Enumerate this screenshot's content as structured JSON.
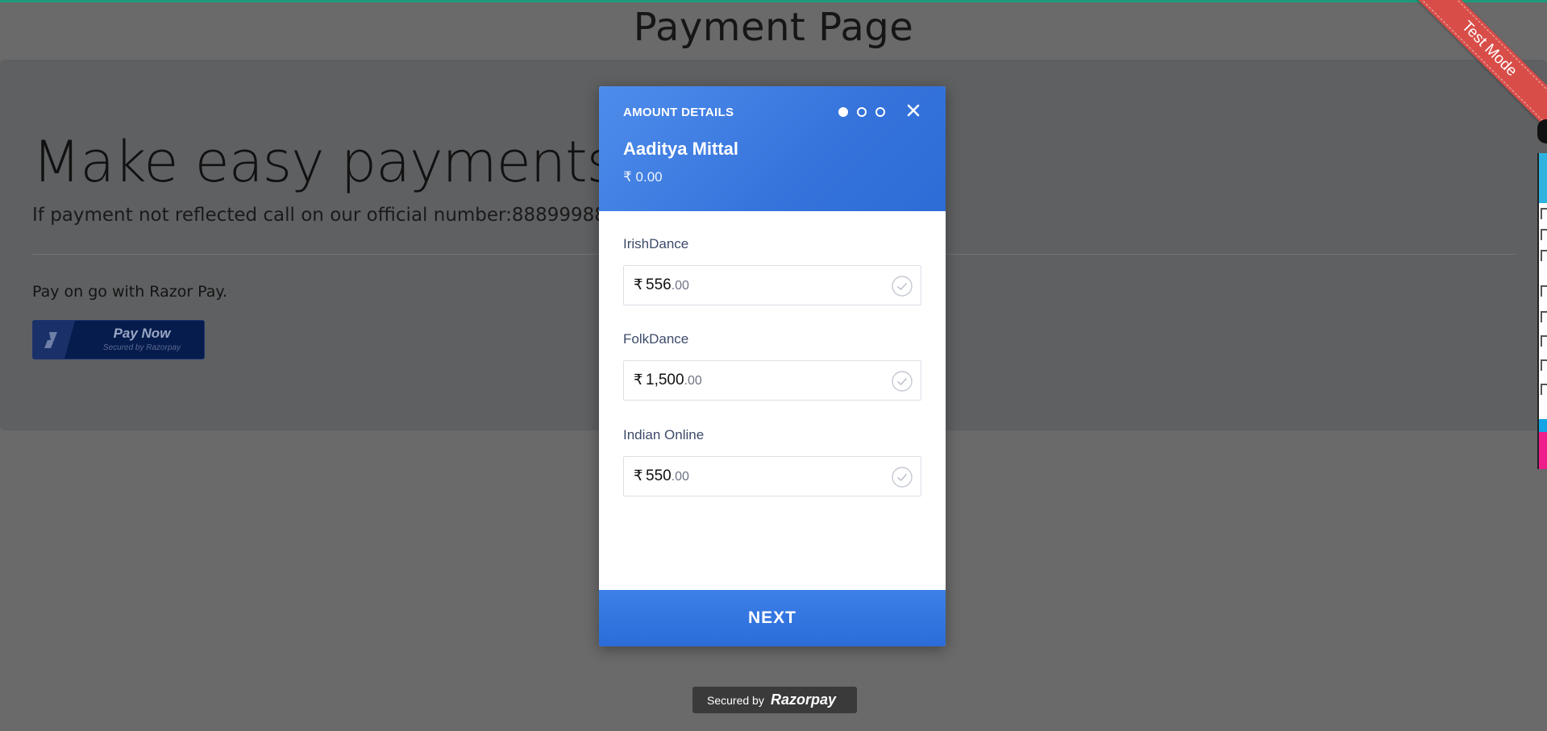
{
  "page": {
    "title": "Payment Page",
    "hero_title": "Make easy payments!",
    "hero_subtitle": "If payment not reflected call on our official number:88899988.",
    "pay_text": "Pay on go with Razor Pay.",
    "pay_button": {
      "label": "Pay Now",
      "secured": "Secured by Razorpay"
    }
  },
  "ribbon": {
    "label": "Test Mode",
    "color": "#d84d48"
  },
  "checkout": {
    "header_label": "AMOUNT DETAILS",
    "merchant_name": "Aaditya Mittal",
    "total": "₹ 0.00",
    "steps": {
      "total": 3,
      "current": 1
    },
    "fields": [
      {
        "label": "IrishDance",
        "currency": "₹",
        "integer": "556",
        "decimals": ".00"
      },
      {
        "label": "FolkDance",
        "currency": "₹",
        "integer": "1,500",
        "decimals": ".00"
      },
      {
        "label": "Indian Online",
        "currency": "₹",
        "integer": "550",
        "decimals": ".00"
      }
    ],
    "next_label": "NEXT",
    "accent_color": "#3674dc"
  },
  "footer": {
    "secured_by": "Secured by",
    "brand": "Razorpay"
  }
}
